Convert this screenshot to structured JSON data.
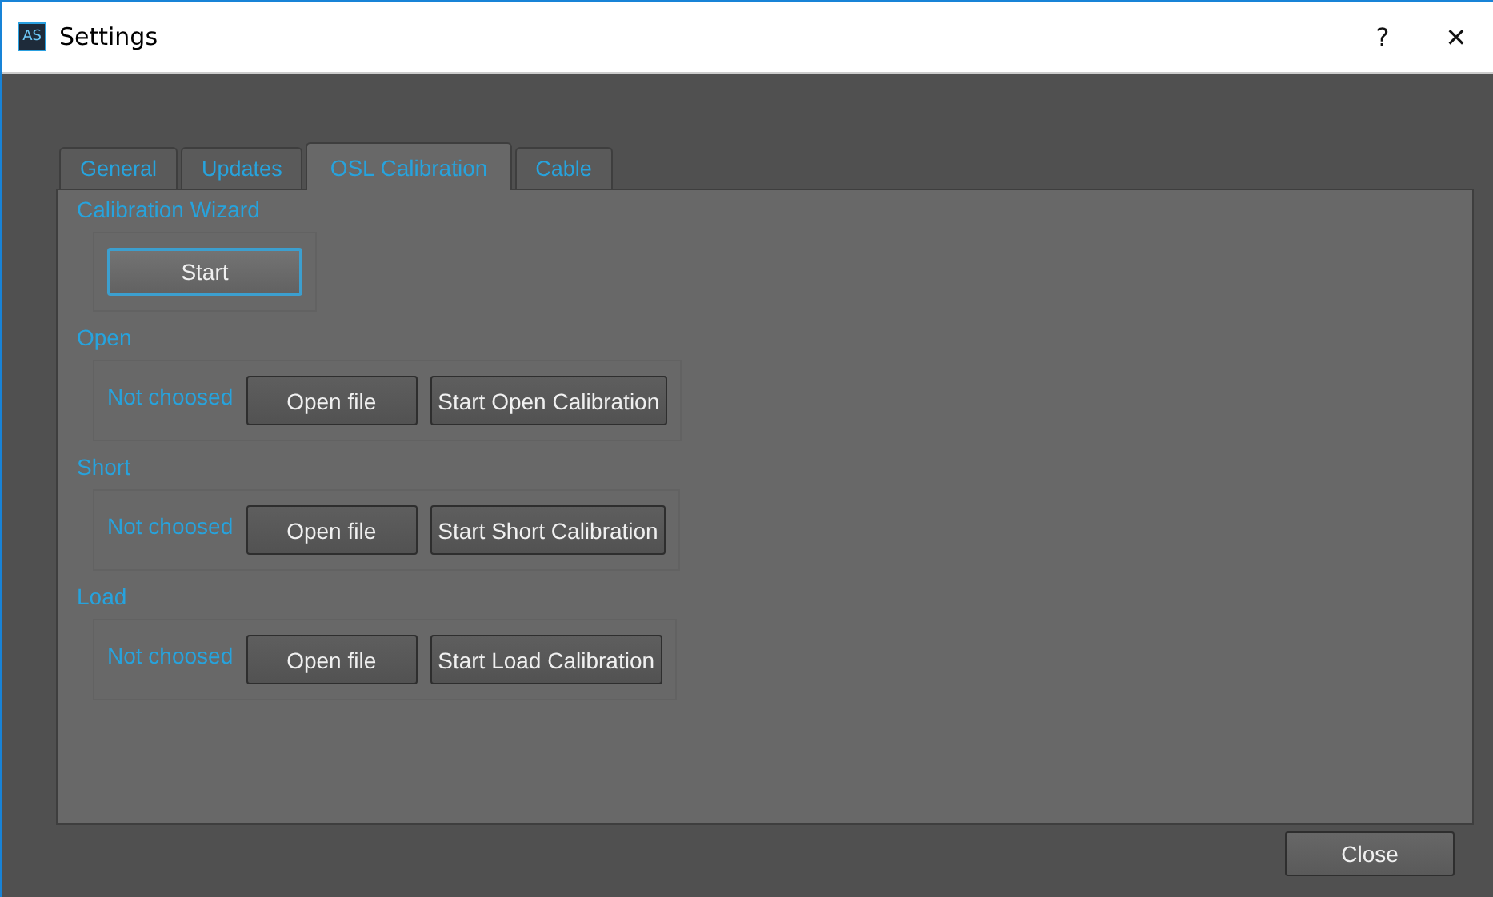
{
  "window": {
    "icon_text": "AS",
    "title": "Settings",
    "help": "?",
    "close": "✕"
  },
  "tabs": [
    {
      "label": "General",
      "selected": false
    },
    {
      "label": "Updates",
      "selected": false
    },
    {
      "label": "OSL Calibration",
      "selected": true
    },
    {
      "label": "Cable",
      "selected": false
    }
  ],
  "wizard": {
    "title": "Calibration Wizard",
    "button": {
      "label": "Start",
      "focused": true
    }
  },
  "sections": [
    {
      "title": "Open",
      "status": "Not choosed",
      "open_button": "Open file",
      "start_button": "Start Open Calibration"
    },
    {
      "title": "Short",
      "status": "Not choosed",
      "open_button": "Open file",
      "start_button": "Start Short Calibration"
    },
    {
      "title": "Load",
      "status": "Not choosed",
      "open_button": "Open file",
      "start_button": "Start Load Calibration"
    }
  ],
  "close_button": "Close"
}
